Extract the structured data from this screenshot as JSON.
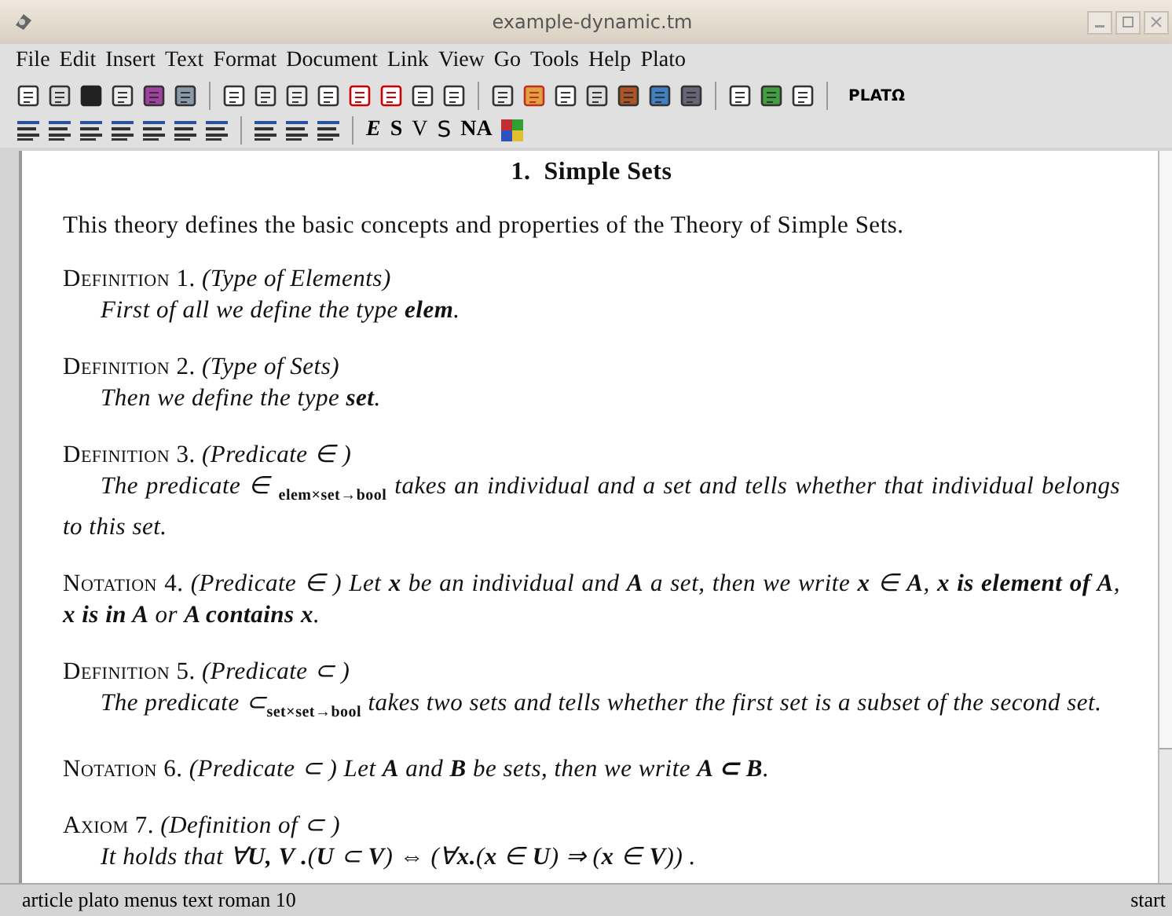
{
  "window": {
    "title": "example-dynamic.tm"
  },
  "menu": [
    "File",
    "Edit",
    "Insert",
    "Text",
    "Format",
    "Document",
    "Link",
    "View",
    "Go",
    "Tools",
    "Help",
    "Plato"
  ],
  "toolbar": {
    "plato_label": "PLATΩ"
  },
  "format_bar": {
    "letters": [
      {
        "label": "E",
        "kind": "italic"
      },
      {
        "label": "S",
        "kind": "bold"
      },
      {
        "label": "V",
        "kind": "plain"
      },
      {
        "label": "S",
        "kind": "sans"
      },
      {
        "label": "NA",
        "kind": "smallcaps"
      }
    ]
  },
  "document": {
    "heading": "1.  Simple Sets",
    "blocks": [
      {
        "kind": "paragraph",
        "text": "This theory defines the basic concepts and properties of the Theory of Simple Sets."
      },
      {
        "kind": "definition",
        "label": "Definition 1.",
        "title": "(Type of Elements)",
        "body": "First of all we define the type **elem**."
      },
      {
        "kind": "definition",
        "label": "Definition 2.",
        "title": "(Type of Sets)",
        "body": "Then we define the type **set**."
      },
      {
        "kind": "definition",
        "label": "Definition 3.",
        "title": "(Predicate ∈ )",
        "body": "The predicate  ∈ $_{elem×set→bool}$ takes an individual and a set and tells whether that individual belongs to this set."
      },
      {
        "kind": "notation",
        "label": "Notation 4.",
        "title": "(Predicate  ∈ )",
        "body": "Let **x** be an individual and **A** a set, then we write **x** ∈ **A**, **x is element of A**, **x is in A** or **A contains x**."
      },
      {
        "kind": "definition",
        "label": "Definition 5.",
        "title": "(Predicate ⊂ )",
        "body": "The predicate ⊂$_{set×set→bool}$ takes two sets and tells whether the first set is a subset of the second set."
      },
      {
        "kind": "notation",
        "label": "Notation 6.",
        "title": "(Predicate ⊂ )",
        "body": "Let **A** and **B** be sets, then we write **A ⊂ B**."
      },
      {
        "kind": "definition",
        "label": "Axiom 7.",
        "title": "(Definition of ⊂ )",
        "body": "It holds that ∀**U, V .**(**U** ⊂ **V**) ⇔ (∀**x.**(**x** ∈ **U**) ⇒ (**x** ∈ **V**)) ."
      }
    ]
  },
  "status_bar": {
    "left": "article plato menus text roman 10",
    "right": "start"
  }
}
